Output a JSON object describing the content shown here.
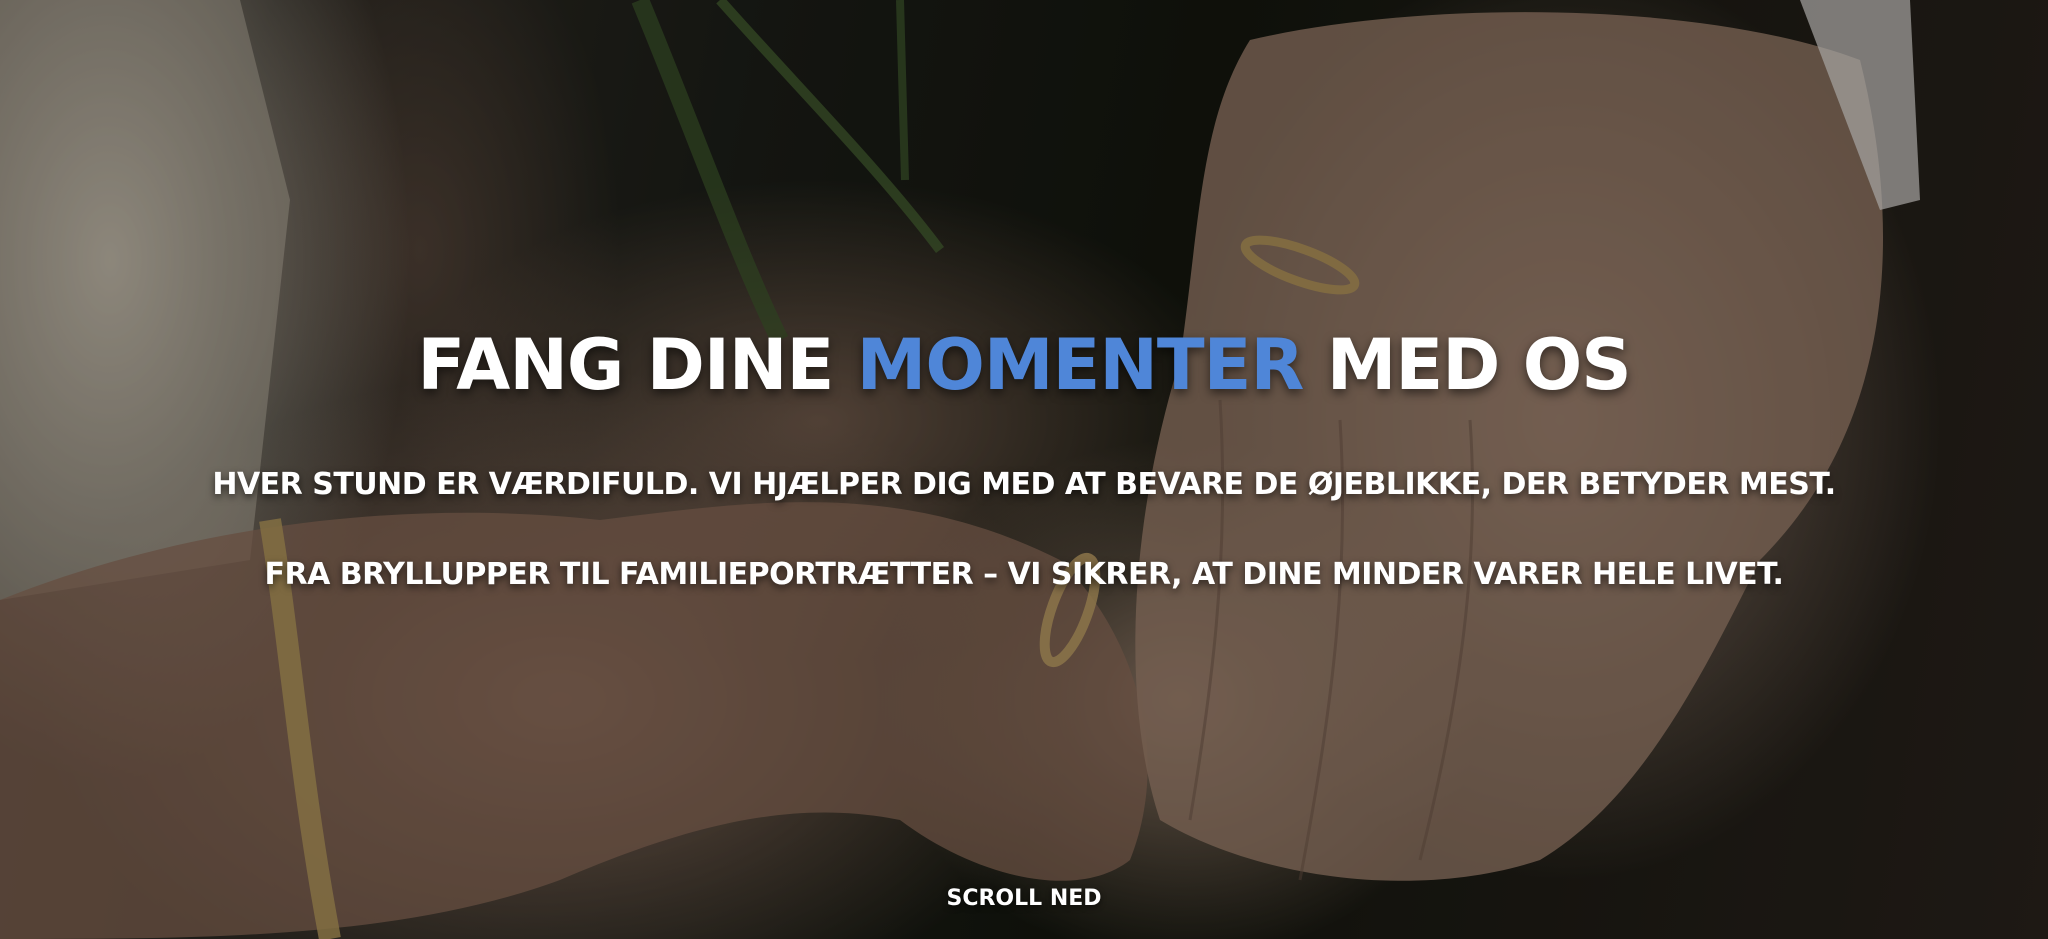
{
  "hero": {
    "headline_before": "FANG DINE",
    "headline_accent": "MOMENTER",
    "headline_after": "MED OS",
    "accent_color": "#4f86d8",
    "tagline_1": "HVER STUND ER VÆRDIFULD. VI HJÆLPER DIG MED AT BEVARE DE ØJEBLIKKE, DER BETYDER MEST.",
    "tagline_2": "FRA BRYLLUPPER TIL FAMILIEPORTRÆTTER – VI SIKRER, AT DINE MINDER VARER HELE LIVET.",
    "scroll_label": "SCROLL NED"
  }
}
